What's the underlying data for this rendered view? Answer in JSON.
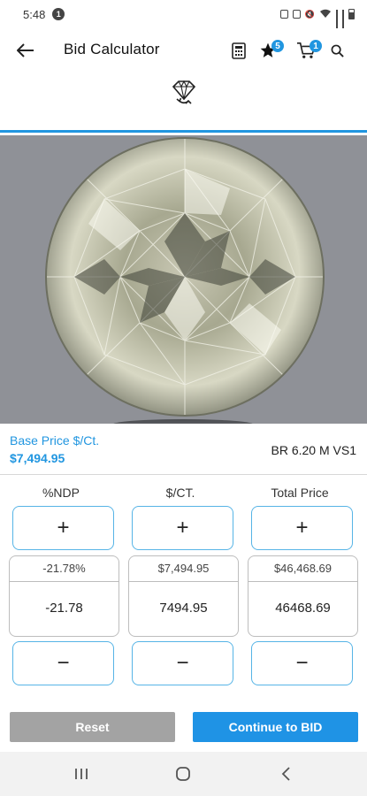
{
  "status_bar": {
    "time": "5:48",
    "notification_badge": "1"
  },
  "header": {
    "title": "Bid Calculator",
    "favorites_count": "5",
    "cart_count": "1",
    "icons": [
      "back-arrow-icon",
      "calculator-icon",
      "star-icon",
      "cart-icon",
      "search-icon",
      "diamond-shape-icon"
    ],
    "accent_color": "#2196e0"
  },
  "stone": {
    "base_price_label": "Base Price $/Ct.",
    "base_price_value": "$7,494.95",
    "description": "BR 6.20 M VS1"
  },
  "calculator": {
    "columns": [
      {
        "header": "%NDP",
        "plus_label": "+",
        "minus_label": "−",
        "display_value": "-21.78%",
        "input_value": "-21.78"
      },
      {
        "header": "$/CT.",
        "plus_label": "+",
        "minus_label": "−",
        "display_value": "$7,494.95",
        "input_value": "7494.95"
      },
      {
        "header": "Total Price",
        "plus_label": "+",
        "minus_label": "−",
        "display_value": "$46,468.69",
        "input_value": "46468.69"
      }
    ]
  },
  "actions": {
    "reset_label": "Reset",
    "continue_label": "Continue to BID",
    "reset_color": "#a3a3a3",
    "continue_color": "#1f93e5"
  },
  "nav_bar": {
    "icons": [
      "recent-apps-icon",
      "home-icon",
      "back-icon"
    ]
  }
}
